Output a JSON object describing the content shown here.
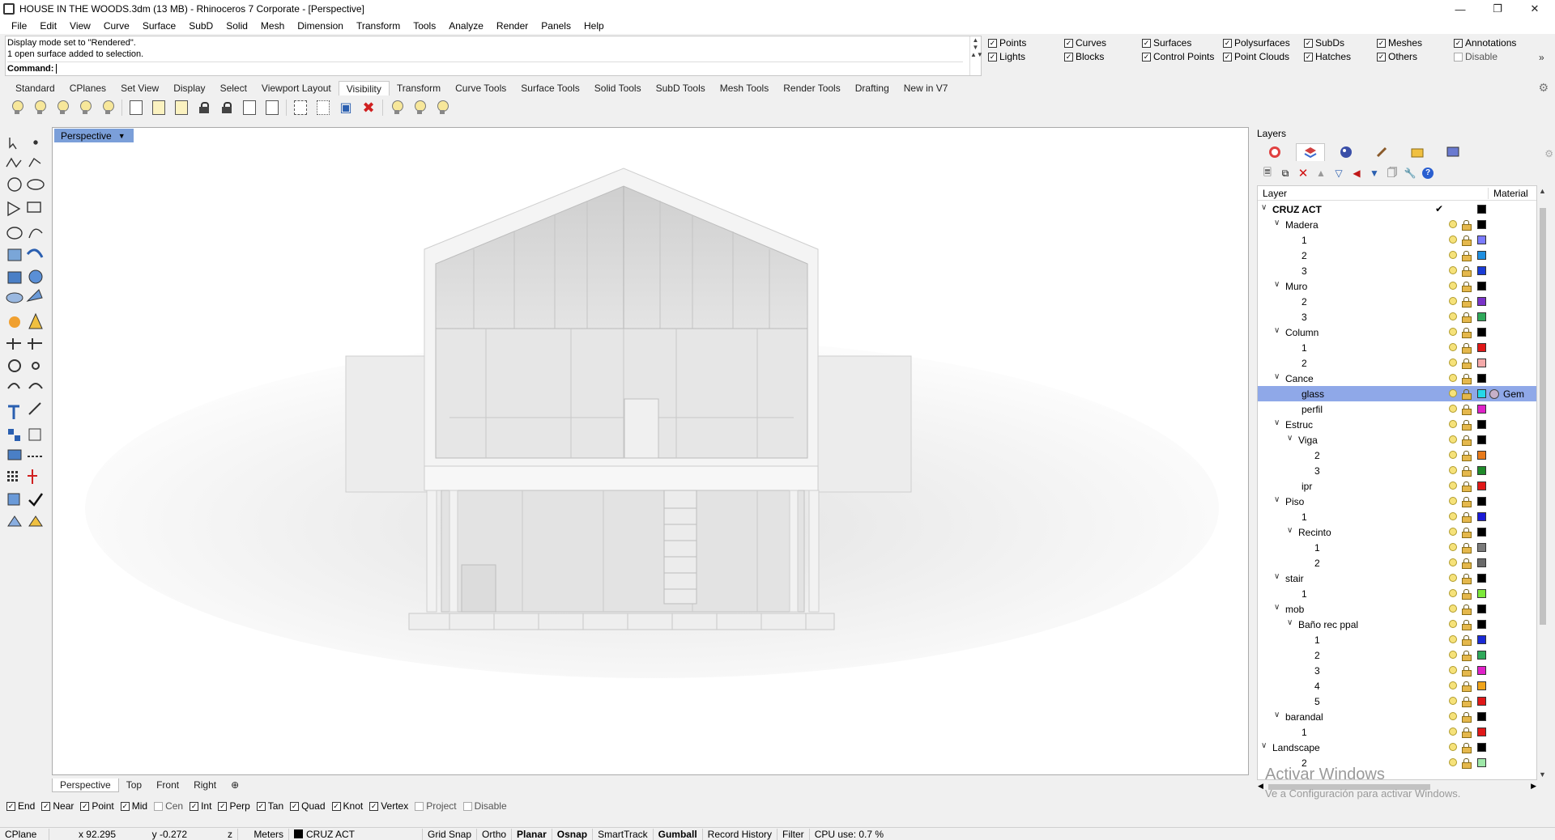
{
  "window": {
    "title": "HOUSE IN THE WOODS.3dm (13 MB) - Rhinoceros 7 Corporate - [Perspective]",
    "minimize_icon": "minimize-icon",
    "maximize_icon": "restore-icon",
    "close_icon": "close-icon"
  },
  "menu": [
    "File",
    "Edit",
    "View",
    "Curve",
    "Surface",
    "SubD",
    "Solid",
    "Mesh",
    "Dimension",
    "Transform",
    "Tools",
    "Analyze",
    "Render",
    "Panels",
    "Help"
  ],
  "command": {
    "history": [
      "Display mode set to \"Rendered\".",
      "1 open surface added to selection."
    ],
    "prompt": "Command:",
    "input_value": ""
  },
  "visibility": [
    {
      "label": "Points",
      "checked": true
    },
    {
      "label": "Curves",
      "checked": true
    },
    {
      "label": "Surfaces",
      "checked": true
    },
    {
      "label": "Polysurfaces",
      "checked": true
    },
    {
      "label": "SubDs",
      "checked": true
    },
    {
      "label": "Meshes",
      "checked": true
    },
    {
      "label": "Annotations",
      "checked": true
    },
    {
      "label": "Lights",
      "checked": true
    },
    {
      "label": "Blocks",
      "checked": true
    },
    {
      "label": "Control Points",
      "checked": true
    },
    {
      "label": "Point Clouds",
      "checked": true
    },
    {
      "label": "Hatches",
      "checked": true
    },
    {
      "label": "Others",
      "checked": true
    },
    {
      "label": "Disable",
      "checked": false
    }
  ],
  "toolbar_tabs": {
    "items": [
      "Standard",
      "CPlanes",
      "Set View",
      "Display",
      "Select",
      "Viewport Layout",
      "Visibility",
      "Transform",
      "Curve Tools",
      "Surface Tools",
      "Solid Tools",
      "SubD Tools",
      "Mesh Tools",
      "Render Tools",
      "Drafting",
      "New in V7"
    ],
    "active": "Visibility"
  },
  "viewport": {
    "name": "Perspective",
    "tabs": [
      "Perspective",
      "Top",
      "Front",
      "Right"
    ],
    "active_tab": "Perspective",
    "add_tab_icon": "add-viewport-icon"
  },
  "osnaps": [
    {
      "label": "End",
      "checked": true
    },
    {
      "label": "Near",
      "checked": true
    },
    {
      "label": "Point",
      "checked": true
    },
    {
      "label": "Mid",
      "checked": true
    },
    {
      "label": "Cen",
      "checked": false
    },
    {
      "label": "Int",
      "checked": true
    },
    {
      "label": "Perp",
      "checked": true
    },
    {
      "label": "Tan",
      "checked": true
    },
    {
      "label": "Quad",
      "checked": true
    },
    {
      "label": "Knot",
      "checked": true
    },
    {
      "label": "Vertex",
      "checked": true
    },
    {
      "label": "Project",
      "checked": false
    },
    {
      "label": "Disable",
      "checked": false
    }
  ],
  "statusbar": {
    "cplane": "CPlane",
    "x": "x 92.295",
    "y": "y -0.272",
    "z": "z",
    "units": "Meters",
    "layer": "CRUZ ACT",
    "grid_snap": "Grid Snap",
    "ortho": "Ortho",
    "planar": "Planar",
    "osnap": "Osnap",
    "smarttrack": "SmartTrack",
    "gumball": "Gumball",
    "record_history": "Record History",
    "filter": "Filter",
    "cpu": "CPU use: 0.7 %"
  },
  "layers_panel": {
    "title": "Layers",
    "col_layer": "Layer",
    "col_material": "Material",
    "rows": [
      {
        "name": "CRUZ ACT",
        "level": 0,
        "expander": true,
        "bold": true,
        "current": true,
        "color": "#000000"
      },
      {
        "name": "Madera",
        "level": 1,
        "expander": true,
        "color": "#000000"
      },
      {
        "name": "1",
        "level": 2,
        "color": "#7b7bff"
      },
      {
        "name": "2",
        "level": 2,
        "color": "#1f8fe0"
      },
      {
        "name": "3",
        "level": 2,
        "color": "#1a3cd6"
      },
      {
        "name": "Muro",
        "level": 1,
        "expander": true,
        "color": "#000000"
      },
      {
        "name": "2",
        "level": 2,
        "color": "#7a33c8"
      },
      {
        "name": "3",
        "level": 2,
        "color": "#2fa85a"
      },
      {
        "name": "Column",
        "level": 1,
        "expander": true,
        "color": "#000000"
      },
      {
        "name": "1",
        "level": 2,
        "color": "#e01818"
      },
      {
        "name": "2",
        "level": 2,
        "color": "#f4a9a9"
      },
      {
        "name": "Cance",
        "level": 1,
        "expander": true,
        "color": "#000000"
      },
      {
        "name": "glass",
        "level": 2,
        "selected": true,
        "color": "#25d8e8",
        "material": "Gem"
      },
      {
        "name": "perfil",
        "level": 2,
        "color": "#e021c8"
      },
      {
        "name": "Estruc",
        "level": 1,
        "expander": true,
        "color": "#000000"
      },
      {
        "name": "Viga",
        "level": 2,
        "expander": true,
        "color": "#000000"
      },
      {
        "name": "2",
        "level": 3,
        "color": "#e87a1a"
      },
      {
        "name": "3",
        "level": 3,
        "color": "#1f8a2a"
      },
      {
        "name": "ipr",
        "level": 2,
        "color": "#e01818"
      },
      {
        "name": "Piso",
        "level": 1,
        "expander": true,
        "color": "#000000"
      },
      {
        "name": "1",
        "level": 2,
        "color": "#1a1ad6"
      },
      {
        "name": "Recinto",
        "level": 2,
        "expander": true,
        "color": "#000000"
      },
      {
        "name": "1",
        "level": 3,
        "color": "#7a7a7a"
      },
      {
        "name": "2",
        "level": 3,
        "color": "#6a6a6a"
      },
      {
        "name": "stair",
        "level": 1,
        "expander": true,
        "color": "#000000"
      },
      {
        "name": "1",
        "level": 2,
        "color": "#7ce83a"
      },
      {
        "name": "mob",
        "level": 1,
        "expander": true,
        "color": "#000000"
      },
      {
        "name": "Baño rec ppal",
        "level": 2,
        "expander": true,
        "color": "#000000"
      },
      {
        "name": "1",
        "level": 3,
        "color": "#1a2ad6"
      },
      {
        "name": "2",
        "level": 3,
        "color": "#2fa85a"
      },
      {
        "name": "3",
        "level": 3,
        "color": "#e021c8"
      },
      {
        "name": "4",
        "level": 3,
        "color": "#f0a41a"
      },
      {
        "name": "5",
        "level": 3,
        "color": "#e01818"
      },
      {
        "name": "barandal",
        "level": 1,
        "expander": true,
        "color": "#000000"
      },
      {
        "name": "1",
        "level": 2,
        "color": "#e01818"
      },
      {
        "name": "Landscape",
        "level": 0,
        "expander": true,
        "color": "#000000"
      },
      {
        "name": "2",
        "level": 2,
        "color": "#9ee8a8"
      }
    ]
  },
  "watermark": {
    "line1": "Activar Windows",
    "line2": "Ve a Configuración para activar Windows."
  }
}
